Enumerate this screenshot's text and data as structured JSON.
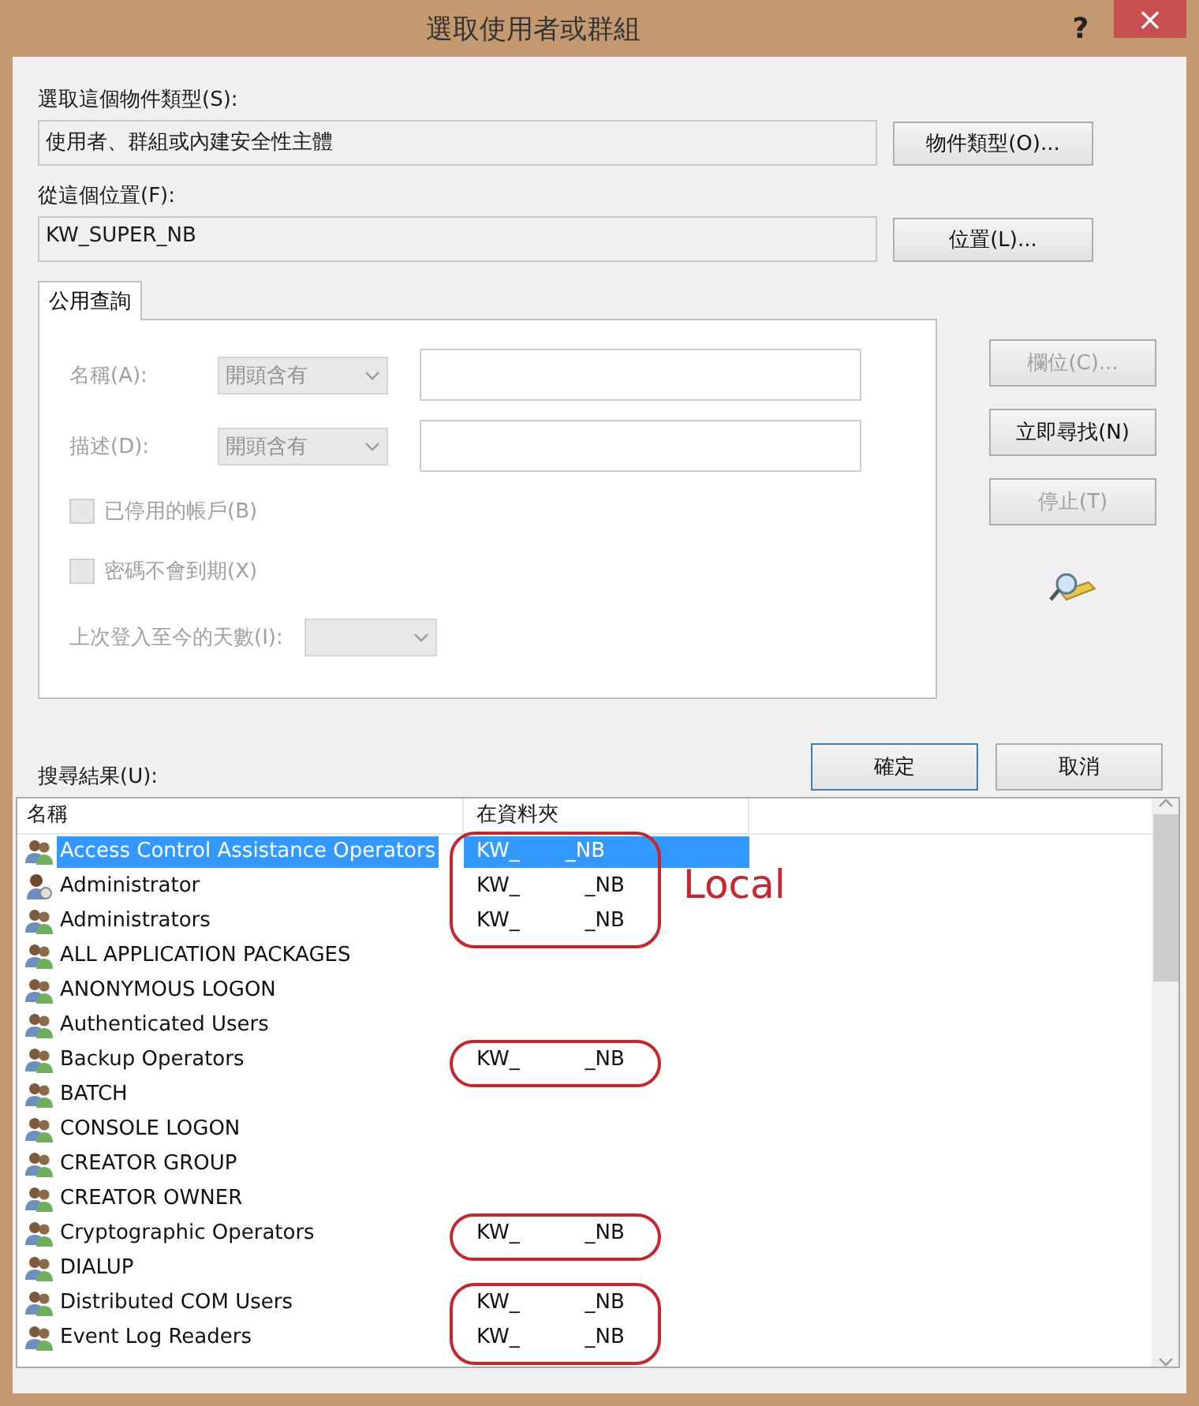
{
  "window": {
    "title": "選取使用者或群組",
    "help": "?",
    "close": "×"
  },
  "object_type": {
    "label": "選取這個物件類型(S):",
    "value": "使用者、群組或內建安全性主體",
    "button": "物件類型(O)..."
  },
  "location": {
    "label": "從這個位置(F):",
    "value": "KW_SUPER_NB",
    "button": "位置(L)..."
  },
  "tabs": [
    {
      "label": "公用查詢",
      "selected": true
    }
  ],
  "query": {
    "disabled": true,
    "name": {
      "label": "名稱(A):",
      "mode": "開頭含有"
    },
    "description": {
      "label": "描述(D):",
      "mode": "開頭含有"
    },
    "checkboxes": [
      {
        "label": "已停用的帳戶(B)",
        "checked": false
      },
      {
        "label": "密碼不會到期(X)",
        "checked": false
      }
    ],
    "days": {
      "label": "上次登入至今的天數(I):"
    }
  },
  "side_buttons": [
    {
      "label": "欄位(C)...",
      "disabled": true
    },
    {
      "label": "立即尋找(N)",
      "disabled": false
    },
    {
      "label": "停止(T)",
      "disabled": true
    }
  ],
  "dialog_buttons": [
    {
      "label": "確定",
      "default": true
    },
    {
      "label": "取消",
      "default": false
    }
  ],
  "results": {
    "label": "搜尋結果(U):",
    "columns": [
      "名稱",
      "在資料夾"
    ],
    "rows": [
      {
        "kind": "group",
        "name": "Access Control Assistance Operators",
        "folder": "KW_       _NB",
        "selected": true,
        "circled": true
      },
      {
        "kind": "user",
        "name": "Administrator",
        "folder": "KW_          _NB",
        "selected": false,
        "circled": true
      },
      {
        "kind": "group",
        "name": "Administrators",
        "folder": "KW_          _NB",
        "selected": false,
        "circled": true
      },
      {
        "kind": "group",
        "name": "ALL APPLICATION PACKAGES",
        "selected": false,
        "circled": false
      },
      {
        "kind": "group",
        "name": "ANONYMOUS LOGON",
        "selected": false,
        "circled": false
      },
      {
        "kind": "group",
        "name": "Authenticated Users",
        "selected": false,
        "circled": false
      },
      {
        "kind": "group",
        "name": "Backup Operators",
        "folder": "KW_          _NB",
        "selected": false,
        "circled": true
      },
      {
        "kind": "group",
        "name": "BATCH",
        "selected": false,
        "circled": false
      },
      {
        "kind": "group",
        "name": "CONSOLE LOGON",
        "selected": false,
        "circled": false
      },
      {
        "kind": "group",
        "name": "CREATOR GROUP",
        "selected": false,
        "circled": false
      },
      {
        "kind": "group",
        "name": "CREATOR OWNER",
        "selected": false,
        "circled": false
      },
      {
        "kind": "group",
        "name": "Cryptographic Operators",
        "folder": "KW_          _NB",
        "selected": false,
        "circled": true
      },
      {
        "kind": "group",
        "name": "DIALUP",
        "selected": false,
        "circled": false
      },
      {
        "kind": "group",
        "name": "Distributed COM Users",
        "folder": "KW_          _NB",
        "selected": false,
        "circled": true
      },
      {
        "kind": "group",
        "name": "Event Log Readers",
        "folder": "KW_          _NB",
        "selected": false,
        "circled": true
      }
    ],
    "note": "Local"
  }
}
